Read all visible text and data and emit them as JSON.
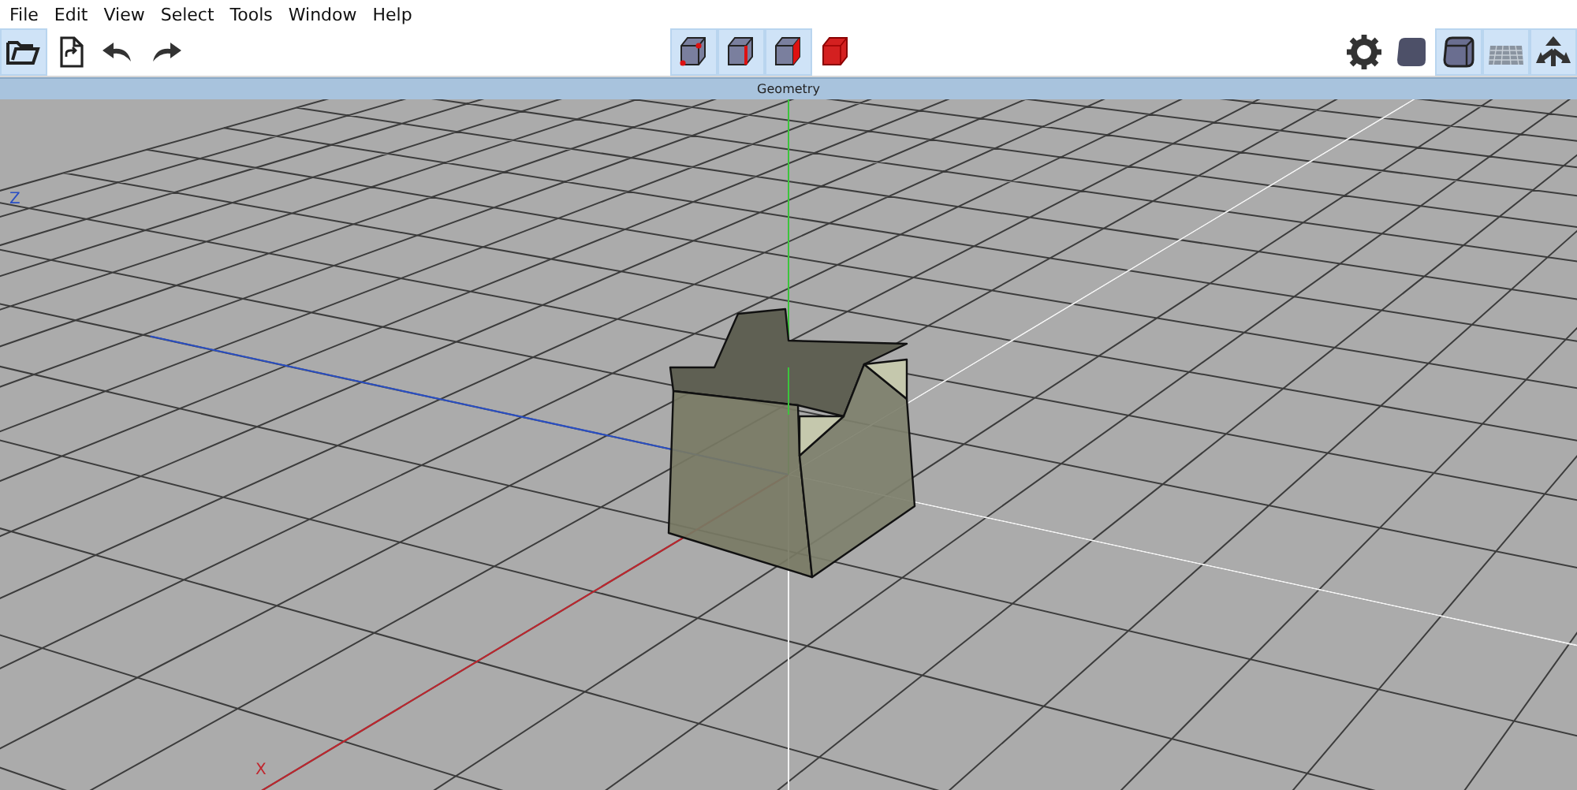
{
  "menu": [
    "File",
    "Edit",
    "View",
    "Select",
    "Tools",
    "Window",
    "Help"
  ],
  "toolbar_left": [
    {
      "kind": "open",
      "selected": true
    },
    {
      "kind": "document",
      "selected": false
    },
    {
      "kind": "undo",
      "selected": false
    },
    {
      "kind": "redo",
      "selected": false
    }
  ],
  "toolbar_center": [
    {
      "kind": "vertex",
      "selected": true
    },
    {
      "kind": "edge",
      "selected": true
    },
    {
      "kind": "face",
      "selected": true
    },
    {
      "kind": "solid",
      "selected": false
    }
  ],
  "toolbar_right": [
    {
      "kind": "gear",
      "selected": false
    },
    {
      "kind": "shaded",
      "selected": false
    },
    {
      "kind": "outlined",
      "selected": true
    },
    {
      "kind": "grid",
      "selected": true
    },
    {
      "kind": "axes",
      "selected": true
    }
  ],
  "viewport": {
    "title": "Geometry",
    "axis_labels": [
      {
        "kind": "z",
        "text": "Z"
      },
      {
        "kind": "x",
        "text": "X"
      }
    ]
  }
}
